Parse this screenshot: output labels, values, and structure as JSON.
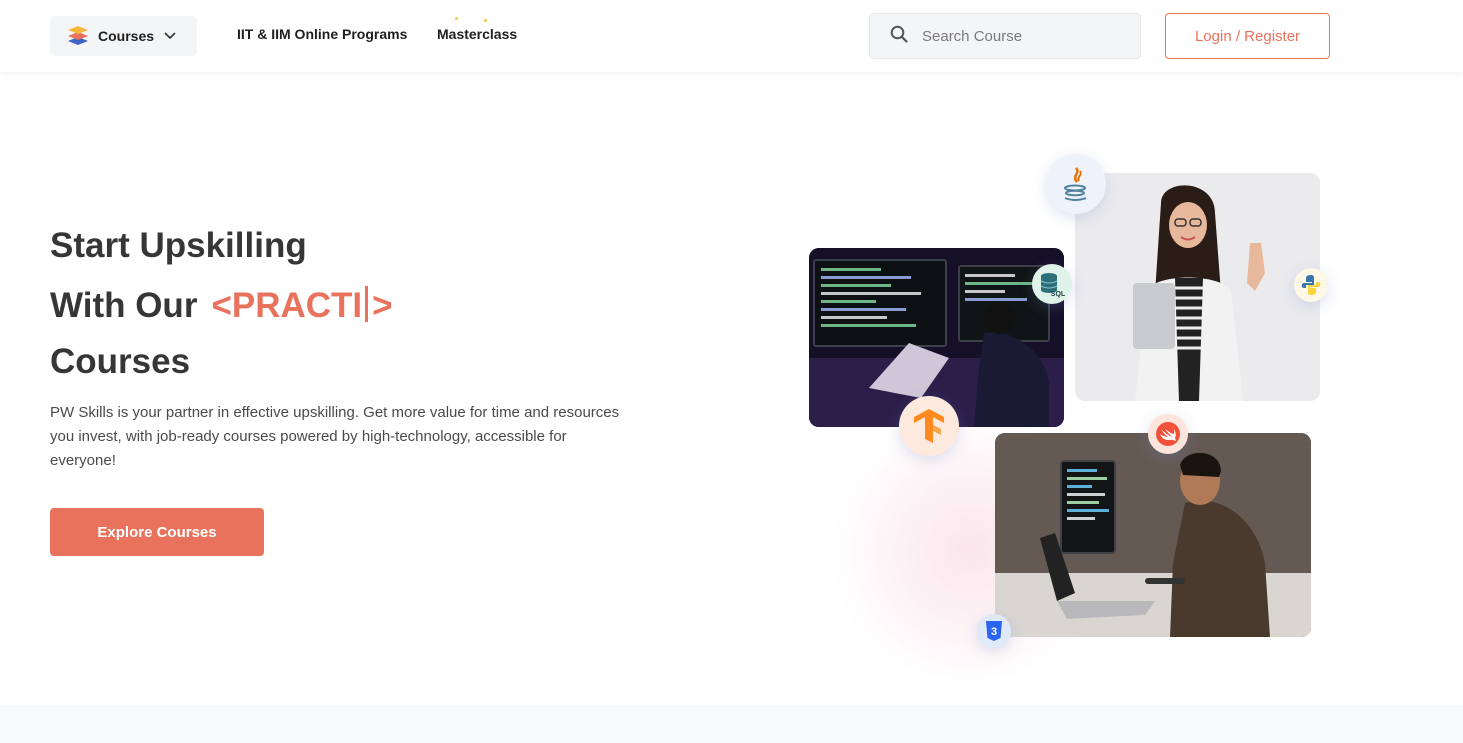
{
  "header": {
    "courses_label": "Courses",
    "nav": {
      "iit_label": "IIT & IIM Online Programs",
      "masterclass_label": "Masterclass"
    },
    "search": {
      "placeholder": "Search Course"
    },
    "login_label": "Login / Register"
  },
  "hero": {
    "line1": "Start Upskilling",
    "line2_prefix": "With Our",
    "typed_open": "<PRACTI",
    "typed_close": ">",
    "line3": "Courses",
    "description": "PW Skills is your partner in effective upskilling. Get more value for time and resources you invest, with job-ready courses powered by high-technology, accessible for everyone!",
    "cta_label": "Explore Courses"
  },
  "tech_badges": {
    "sql_text": "SQL",
    "css_text": "3"
  },
  "colors": {
    "accent": "#e8725c",
    "heading": "#363636",
    "header_bg": "#ffffff",
    "chip_bg": "#f4f5f7"
  }
}
